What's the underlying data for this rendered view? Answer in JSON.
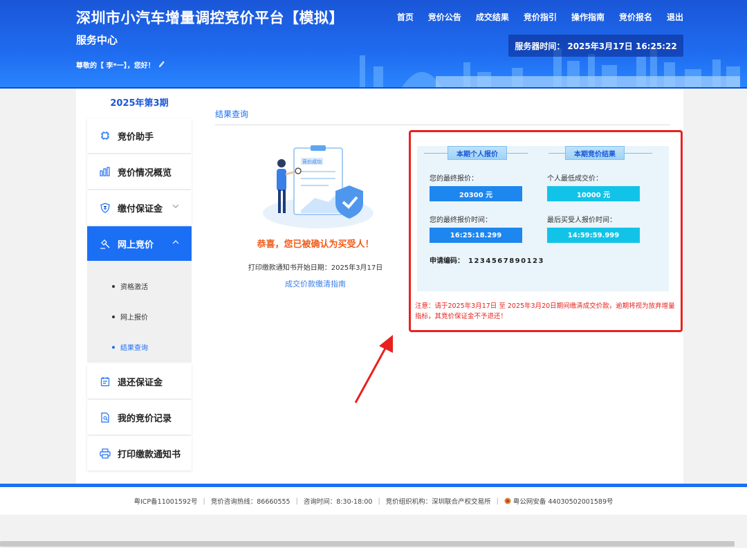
{
  "header": {
    "title": "深圳市小汽车增量调控竞价平台【模拟】",
    "subtitle": "服务中心",
    "greeting": "尊敬的【 李*一】，您好！",
    "server_time_label": "服务器时间：",
    "server_time_value": "2025年3月17日 16:25:22",
    "nav": [
      "首页",
      "竞价公告",
      "成交结果",
      "竞价指引",
      "操作指南",
      "竞价报名",
      "退出"
    ]
  },
  "sidebar": {
    "period": "2025年第3期",
    "items": [
      {
        "label": "竞价助手",
        "icon": "chip-icon"
      },
      {
        "label": "竞价情况概览",
        "icon": "bar-chart-icon"
      },
      {
        "label": "缴付保证金",
        "icon": "shield-yen-icon"
      },
      {
        "label": "网上竞价",
        "icon": "gavel-icon"
      },
      {
        "label": "退还保证金",
        "icon": "calendar-icon"
      },
      {
        "label": "我的竞价记录",
        "icon": "document-search-icon"
      },
      {
        "label": "打印缴款通知书",
        "icon": "printer-icon"
      }
    ],
    "submenu": [
      "资格激活",
      "网上报价",
      "结果查询"
    ]
  },
  "content": {
    "section_title": "结果查询",
    "illustration_badge": "竞价成功",
    "congrats": "恭喜，您已被确认为买受人！",
    "print_date": "打印缴款通知书开始日期：2025年3月17日",
    "guide_link": "成交价款缴清指南"
  },
  "result": {
    "left_header": "本期个人报价",
    "right_header": "本期竞价结果",
    "final_price_label": "您的最终报价：",
    "final_price_value": "20300 元",
    "min_price_label": "个人最低成交价：",
    "min_price_value": "10000 元",
    "final_time_label": "您的最终报价时间：",
    "final_time_value": "16:25:18.299",
    "last_time_label": "最后买受人报价时间：",
    "last_time_value": "14:59:59.999",
    "app_code_label": "申请编码：",
    "app_code_value": "1234567890123",
    "notice": "注意：请于2025年3月17日 至 2025年3月20日期间缴清成交价款，逾期将视为放弃增量指标，其竞价保证金不予退还！"
  },
  "footer": {
    "icp": "粤ICP备11001592号",
    "hotline": "竞价咨询热线：86660555",
    "hours": "咨询时间：8:30-18:00",
    "org": "竞价组织机构：深圳联合产权交易所",
    "police": "粤公网安备 44030502001589号"
  },
  "colors": {
    "brand": "#1b6ff5",
    "alert": "#e8211f",
    "congrats": "#f05a1a",
    "cyan": "#12c3e8"
  }
}
